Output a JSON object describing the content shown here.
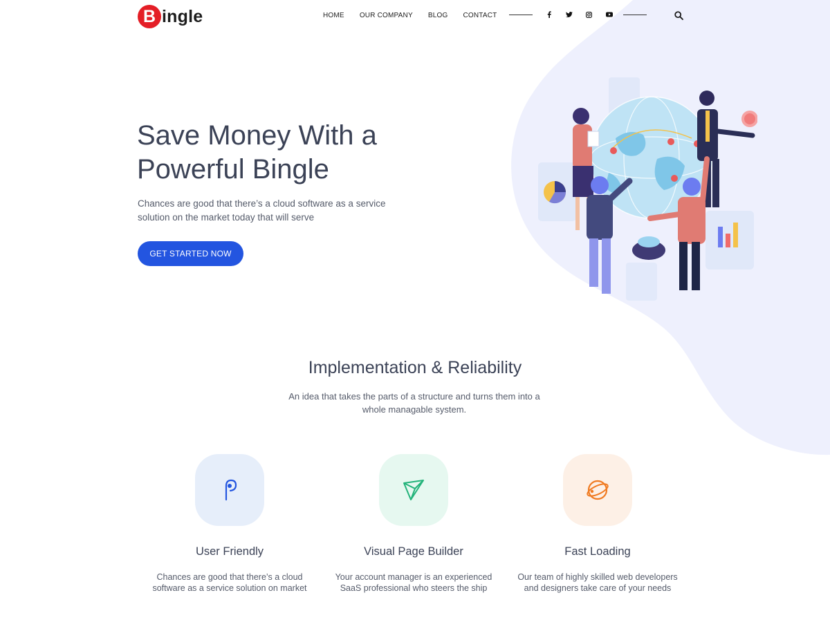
{
  "header": {
    "logo_letter": "B",
    "logo_rest": "ingle",
    "nav": [
      {
        "label": "HOME"
      },
      {
        "label": "OUR COMPANY"
      },
      {
        "label": "BLOG"
      },
      {
        "label": "CONTACT"
      }
    ],
    "social_icons": [
      "facebook-icon",
      "twitter-icon",
      "instagram-icon",
      "youtube-icon"
    ],
    "search_icon": "search-icon"
  },
  "hero": {
    "title_line1": "Save Money With a",
    "title_line2": "Powerful Bingle",
    "subtitle": "Chances are good that there’s a cloud software as a service solution on the market today that will serve",
    "cta_label": "GET STARTED NOW"
  },
  "section": {
    "title": "Implementation & Reliability",
    "subtitle": "An idea that takes the parts of a structure and turns them into a whole managable system."
  },
  "features": [
    {
      "title": "User Friendly",
      "text": "Chances are good that there’s a cloud software as a service solution on market",
      "icon": "pointer-icon"
    },
    {
      "title": "Visual Page Builder",
      "text": "Your account manager is an experienced SaaS professional who steers the ship",
      "icon": "paper-plane-icon"
    },
    {
      "title": "Fast Loading",
      "text": "Our team of highly skilled web developers and designers take care of your needs",
      "icon": "orbit-icon"
    }
  ],
  "colors": {
    "brand_red": "#e41e26",
    "primary_blue": "#2355e0",
    "blob": "#eef0fd",
    "feature_bg_blue": "#e6eefa",
    "feature_bg_green": "#e6f8f0",
    "feature_bg_orange": "#fdf0e6"
  }
}
